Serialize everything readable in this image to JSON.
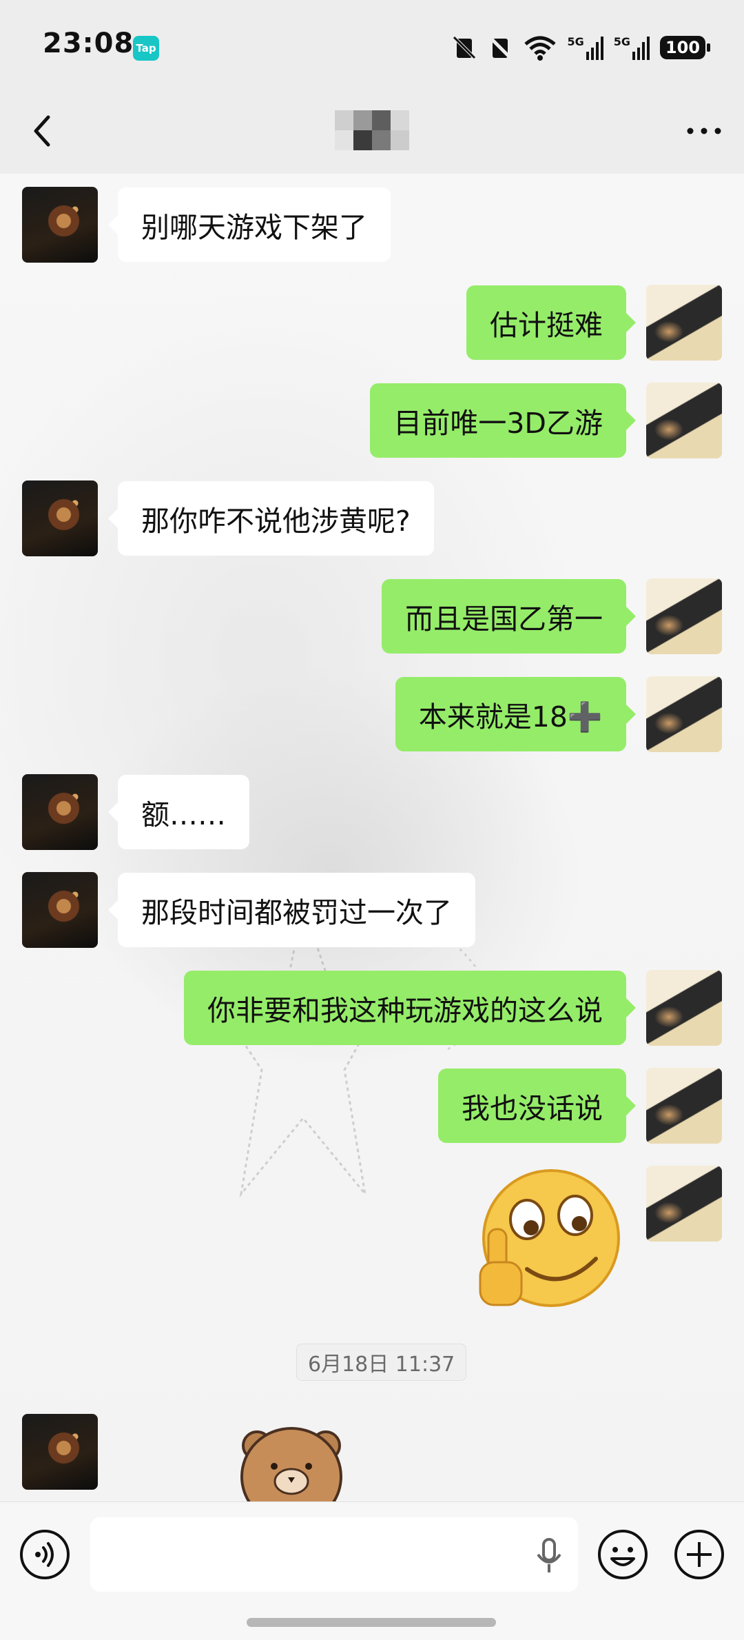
{
  "status_bar": {
    "time": "23:08",
    "app_badge": "Tap",
    "network_1": "5G",
    "network_2": "5G",
    "battery": "100"
  },
  "nav": {
    "back_icon": "chevron-left-icon",
    "title_hidden": "pixelated-contact-name",
    "more_icon": "more-dots-icon"
  },
  "messages": [
    {
      "side": "left",
      "text": "别哪天游戏下架了"
    },
    {
      "side": "right",
      "text": "估计挺难"
    },
    {
      "side": "right",
      "text": "目前唯一3D乙游"
    },
    {
      "side": "left",
      "text": "那你咋不说他涉黄呢?"
    },
    {
      "side": "right",
      "text": "而且是国乙第一"
    },
    {
      "side": "right",
      "text": "本来就是18➕"
    },
    {
      "side": "left",
      "text": "额……"
    },
    {
      "side": "left",
      "text": "那段时间都被罚过一次了"
    },
    {
      "side": "right",
      "text": "你非要和我这种玩游戏的这么说"
    },
    {
      "side": "right",
      "text": "我也没话说"
    },
    {
      "side": "right",
      "type": "sticker",
      "sticker": "smirk-middle-finger-emoji"
    },
    {
      "type": "time",
      "text": "6月18日 11:37"
    },
    {
      "side": "left",
      "type": "sticker",
      "sticker": "brown-bear-sticker"
    }
  ],
  "input_bar": {
    "voice_icon": "voice-mode-icon",
    "mic_icon": "microphone-icon",
    "emoji_icon": "emoji-icon",
    "plus_icon": "plus-icon"
  },
  "colors": {
    "self_bubble": "#95ec69",
    "other_bubble": "#ffffff",
    "background": "#ededed"
  }
}
